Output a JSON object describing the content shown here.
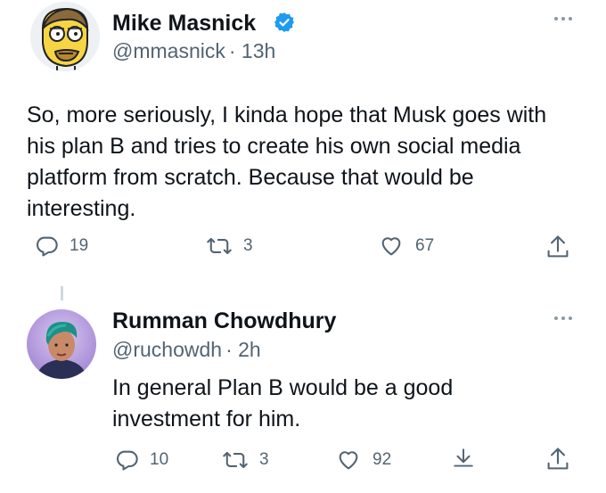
{
  "tweets": [
    {
      "author_name": "Mike Masnick",
      "verified": true,
      "handle": "@mmasnick",
      "time": "· 13h",
      "text": "So, more seriously, I kinda hope that Musk goes with his plan B and tries to create his own social media platform from scratch.  Because that would be interesting.",
      "replies": "19",
      "retweets": "3",
      "likes": "67"
    },
    {
      "author_name": "Rumman Chowdhury",
      "verified": false,
      "handle": "@ruchowdh",
      "time": "· 2h",
      "text": "In general Plan B would be a good investment for him.",
      "replies": "10",
      "retweets": "3",
      "likes": "92"
    }
  ],
  "colors": {
    "text_primary": "#0f1419",
    "text_secondary": "#536471",
    "verified_blue": "#1d9bf0",
    "divider": "#cfd9de"
  },
  "icons": [
    "reply-icon",
    "retweet-icon",
    "like-icon",
    "share-icon",
    "bookmark-download-icon",
    "more-icon",
    "verified-badge-icon"
  ]
}
